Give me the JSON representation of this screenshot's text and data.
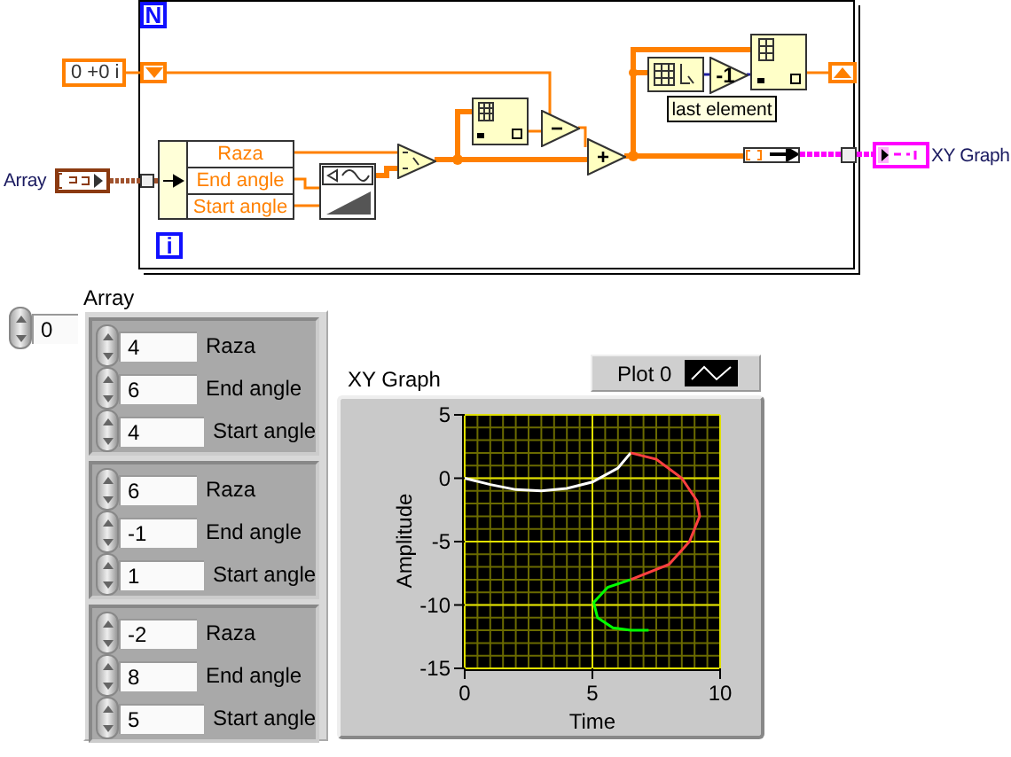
{
  "diagram": {
    "loop": {
      "count_terminal": "N",
      "iteration_terminal": "i"
    },
    "constant": "0 +0 i",
    "array_control": "Array",
    "unbundle_fields": [
      "Raza",
      "End angle",
      "Start angle"
    ],
    "operators": [
      {
        "symbol": "−"
      },
      {
        "symbol": "+"
      },
      {
        "symbol": "-1"
      }
    ],
    "note": "last element",
    "graph_terminal": "XY Graph"
  },
  "panel": {
    "index": "0",
    "array": {
      "label": "Array",
      "elements": [
        {
          "fields": [
            {
              "value": "4",
              "label": "Raza"
            },
            {
              "value": "6",
              "label": "End angle"
            },
            {
              "value": "4",
              "label": "Start angle"
            }
          ]
        },
        {
          "fields": [
            {
              "value": "6",
              "label": "Raza"
            },
            {
              "value": "-1",
              "label": "End angle"
            },
            {
              "value": "1",
              "label": "Start angle"
            }
          ]
        },
        {
          "fields": [
            {
              "value": "-2",
              "label": "Raza"
            },
            {
              "value": "8",
              "label": "End angle"
            },
            {
              "value": "5",
              "label": "Start angle"
            }
          ]
        }
      ]
    },
    "graph": {
      "label": "XY Graph",
      "legend": "Plot 0",
      "chart_data": {
        "type": "line",
        "xlabel": "Time",
        "ylabel": "Amplitude",
        "xlim": [
          0,
          10
        ],
        "ylim": [
          -15,
          5
        ],
        "xticks": [
          0,
          5,
          10
        ],
        "yticks": [
          5,
          0,
          -5,
          -10,
          -15
        ],
        "grid": true,
        "series": [
          {
            "color": "#ffffff",
            "x": [
              0,
              1,
              2,
              3,
              4,
              5,
              6,
              6.5
            ],
            "values": [
              0,
              -0.5,
              -0.9,
              -1,
              -0.8,
              -0.3,
              0.8,
              2
            ]
          },
          {
            "color": "#ff4040",
            "x": [
              6.5,
              7.5,
              8.5,
              9.1,
              9.2,
              8.8,
              8,
              6.5
            ],
            "values": [
              2,
              1.5,
              0,
              -1.8,
              -3,
              -5,
              -6.8,
              -8
            ]
          },
          {
            "color": "#00ff00",
            "x": [
              6.5,
              5.6,
              5.05,
              5.2,
              5.8,
              6.5,
              7.2
            ],
            "values": [
              -8,
              -8.6,
              -9.8,
              -11,
              -11.8,
              -12,
              -12
            ]
          }
        ]
      }
    }
  }
}
